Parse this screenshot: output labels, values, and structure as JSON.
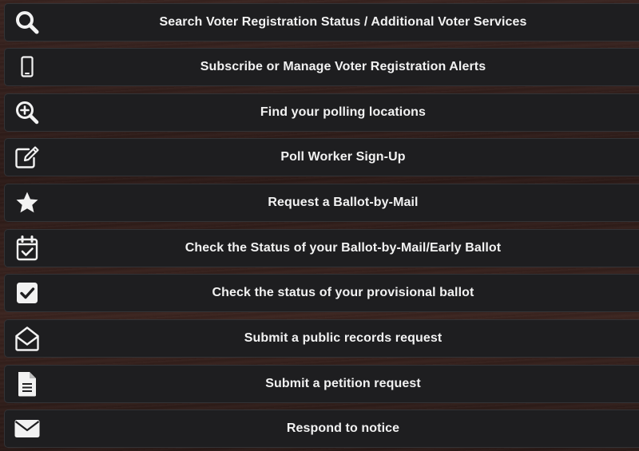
{
  "colors": {
    "item_background": "#1e1e20",
    "text": "#f2f2f2",
    "icon": "#f2f2f2"
  },
  "menu": {
    "items": [
      {
        "label": "Search Voter Registration Status / Additional Voter Services",
        "icon": "search-icon"
      },
      {
        "label": "Subscribe or Manage Voter Registration Alerts",
        "icon": "mobile-phone-icon"
      },
      {
        "label": "Find your polling locations",
        "icon": "zoom-in-icon"
      },
      {
        "label": "Poll Worker Sign-Up",
        "icon": "edit-icon"
      },
      {
        "label": "Request a Ballot-by-Mail",
        "icon": "star-icon"
      },
      {
        "label": "Check the Status of your Ballot-by-Mail/Early Ballot",
        "icon": "calendar-check-icon"
      },
      {
        "label": "Check the status of your provisional ballot",
        "icon": "check-square-icon"
      },
      {
        "label": "Submit a public records request",
        "icon": "envelope-open-icon"
      },
      {
        "label": "Submit a petition request",
        "icon": "file-text-icon"
      },
      {
        "label": "Respond to notice",
        "icon": "envelope-icon"
      }
    ]
  }
}
